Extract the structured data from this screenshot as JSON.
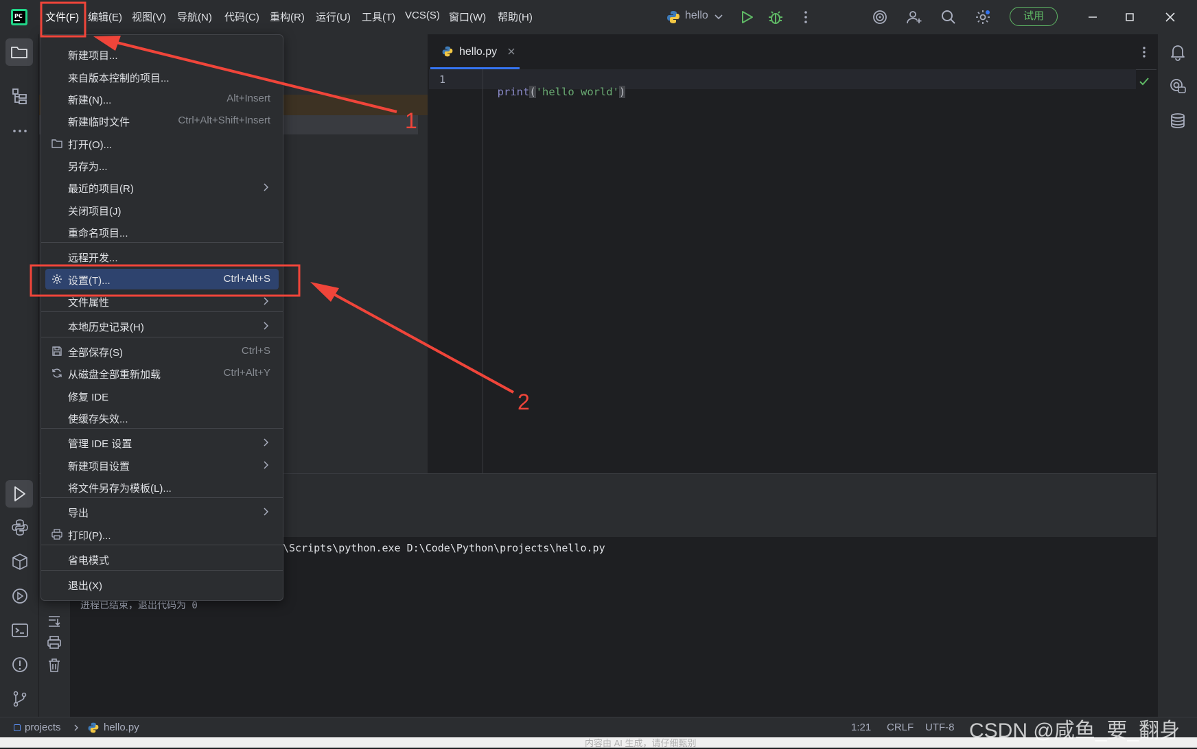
{
  "menubar": {
    "items": [
      "文件(F)",
      "编辑(E)",
      "视图(V)",
      "导航(N)",
      "代码(C)",
      "重构(R)",
      "运行(U)",
      "工具(T)",
      "VCS(S)",
      "窗口(W)",
      "帮助(H)"
    ],
    "project_name": "hello",
    "trial_label": "试用"
  },
  "editor": {
    "tab_title": "hello.py",
    "line_number": "1",
    "code_fn": "print",
    "code_open": "(",
    "code_string": "'hello world'",
    "code_close": ")"
  },
  "run": {
    "command_line": "\\Scripts\\python.exe D:\\Code\\Python\\projects\\hello.py",
    "exit_message": "进程已结束，退出代码为 0"
  },
  "file_menu": {
    "items": [
      {
        "label": "新建项目...",
        "shortcut": ""
      },
      {
        "label": "来自版本控制的项目...",
        "shortcut": ""
      },
      {
        "label": "新建(N)...",
        "shortcut": "Alt+Insert"
      },
      {
        "label": "新建临时文件",
        "shortcut": "Ctrl+Alt+Shift+Insert"
      },
      {
        "label": "打开(O)...",
        "shortcut": "",
        "icon": "folder-icon"
      },
      {
        "label": "另存为...",
        "shortcut": ""
      },
      {
        "label": "最近的项目(R)",
        "shortcut": "",
        "submenu": true
      },
      {
        "label": "关闭项目(J)",
        "shortcut": ""
      },
      {
        "label": "重命名项目...",
        "shortcut": ""
      },
      {
        "label": "远程开发...",
        "shortcut": ""
      },
      {
        "label": "设置(T)...",
        "shortcut": "Ctrl+Alt+S",
        "icon": "gear-icon",
        "selected": true
      },
      {
        "label": "文件属性",
        "shortcut": "",
        "submenu": true
      },
      {
        "label": "本地历史记录(H)",
        "shortcut": "",
        "submenu": true
      },
      {
        "label": "全部保存(S)",
        "shortcut": "Ctrl+S",
        "icon": "save-icon"
      },
      {
        "label": "从磁盘全部重新加载",
        "shortcut": "Ctrl+Alt+Y",
        "icon": "reload-icon"
      },
      {
        "label": "修复 IDE",
        "shortcut": ""
      },
      {
        "label": "使缓存失效...",
        "shortcut": ""
      },
      {
        "label": "管理 IDE 设置",
        "shortcut": "",
        "submenu": true
      },
      {
        "label": "新建项目设置",
        "shortcut": "",
        "submenu": true
      },
      {
        "label": "将文件另存为模板(L)...",
        "shortcut": ""
      },
      {
        "label": "导出",
        "shortcut": "",
        "submenu": true
      },
      {
        "label": "打印(P)...",
        "shortcut": "",
        "icon": "print-icon"
      },
      {
        "label": "省电模式",
        "shortcut": ""
      },
      {
        "label": "退出(X)",
        "shortcut": ""
      }
    ]
  },
  "statusbar": {
    "project": "projects",
    "file": "hello.py",
    "position": "1:21",
    "line_ending": "CRLF",
    "encoding": "UTF-8"
  },
  "annotations": {
    "label_1": "1",
    "label_2": "2",
    "watermark": "CSDN @咸鱼_要_翻身",
    "bottom_text": "内容由 AI 生成，请仔细甄别"
  },
  "colors": {
    "annotation_red": "#f0453a",
    "selected": "#2e436e",
    "accent_green": "#5fb865"
  }
}
